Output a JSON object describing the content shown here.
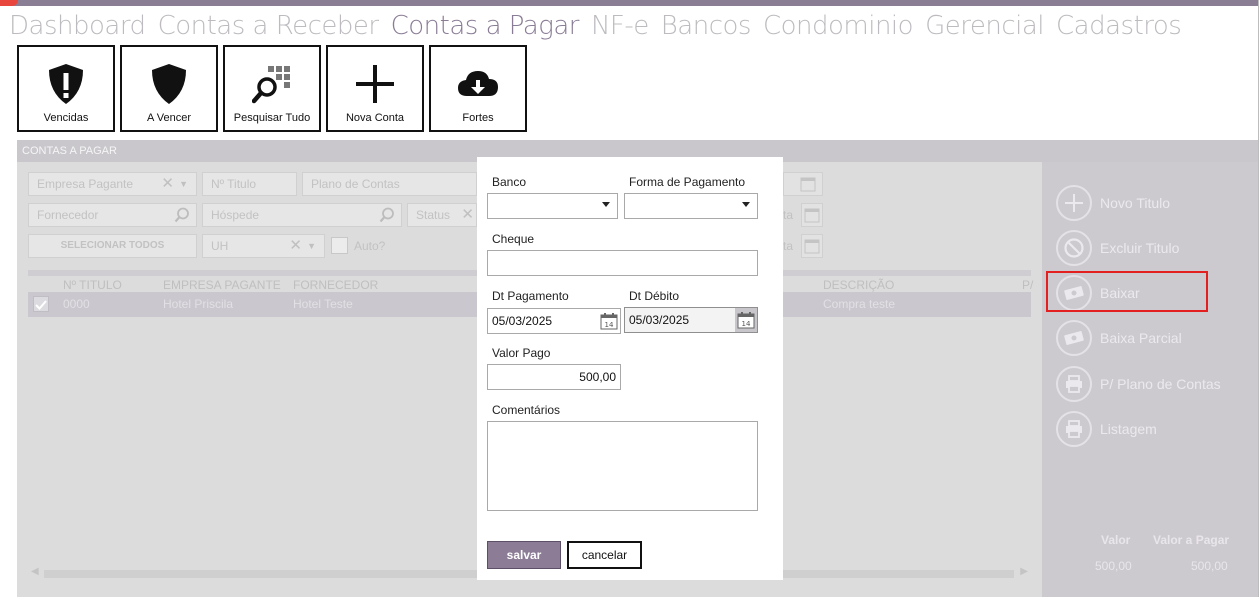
{
  "nav": {
    "items": [
      "Dashboard",
      "Contas a Receber",
      "Contas a Pagar",
      "NF-e",
      "Bancos",
      "Condominio",
      "Gerencial",
      "Cadastros"
    ],
    "active": "Contas a Pagar"
  },
  "tiles": [
    {
      "label": "Vencidas",
      "icon": "shield-exclamation-icon"
    },
    {
      "label": "A Vencer",
      "icon": "shield-icon"
    },
    {
      "label": "Pesquisar Tudo",
      "icon": "grid-search-icon"
    },
    {
      "label": "Nova Conta",
      "icon": "plus-icon"
    },
    {
      "label": "Fortes",
      "icon": "cloud-download-icon"
    }
  ],
  "panel": {
    "title": "CONTAS A PAGAR",
    "filters": {
      "empresa_pagante": "Empresa Pagante",
      "n_titulo": "Nº Titulo",
      "plano_de_contas": "Plano de Contas",
      "fornecedor": "Fornecedor",
      "hospede": "Hóspede",
      "status": "Status",
      "selecionar_todos": "SELECIONAR TODOS",
      "uh": "UH",
      "auto": "Auto?",
      "date_suffix_1": "ta",
      "date_suffix_2": "ta"
    },
    "table": {
      "headers": [
        "Nº TITULO",
        "EMPRESA PAGANTE",
        "FORNECEDOR",
        "DESCRIÇÃO",
        "P/"
      ],
      "rows": [
        {
          "titulo": "0000",
          "empresa": "Hotel Priscila",
          "fornecedor": "Hotel Teste",
          "descricao": "Compra teste"
        }
      ]
    }
  },
  "sidebar": {
    "actions": [
      {
        "label": "Novo Titulo",
        "icon": "plus-circle-icon"
      },
      {
        "label": "Excluir Titulo",
        "icon": "block-icon"
      },
      {
        "label": "Baixar",
        "icon": "money-icon"
      },
      {
        "label": "Baixa Parcial",
        "icon": "money-icon"
      },
      {
        "label": "P/ Plano de Contas",
        "icon": "printer-icon"
      },
      {
        "label": "Listagem",
        "icon": "printer-icon"
      }
    ],
    "totals": {
      "valor_label": "Valor",
      "valor_pagar_label": "Valor a Pagar",
      "valor": "500,00",
      "valor_pagar": "500,00"
    }
  },
  "modal": {
    "banco_label": "Banco",
    "banco_value": "",
    "forma_label": "Forma de Pagamento",
    "forma_value": "",
    "cheque_label": "Cheque",
    "cheque_value": "",
    "dt_pagamento_label": "Dt Pagamento",
    "dt_pagamento_value": "05/03/2025",
    "dt_debito_label": "Dt Débito",
    "dt_debito_value": "05/03/2025",
    "valor_pago_label": "Valor Pago",
    "valor_pago_value": "500,00",
    "comentarios_label": "Comentários",
    "comentarios_value": "",
    "salvar": "salvar",
    "cancelar": "cancelar",
    "calendar_day": "14"
  },
  "colors": {
    "accent": "#8c7c96",
    "highlight": "#e3201f"
  }
}
